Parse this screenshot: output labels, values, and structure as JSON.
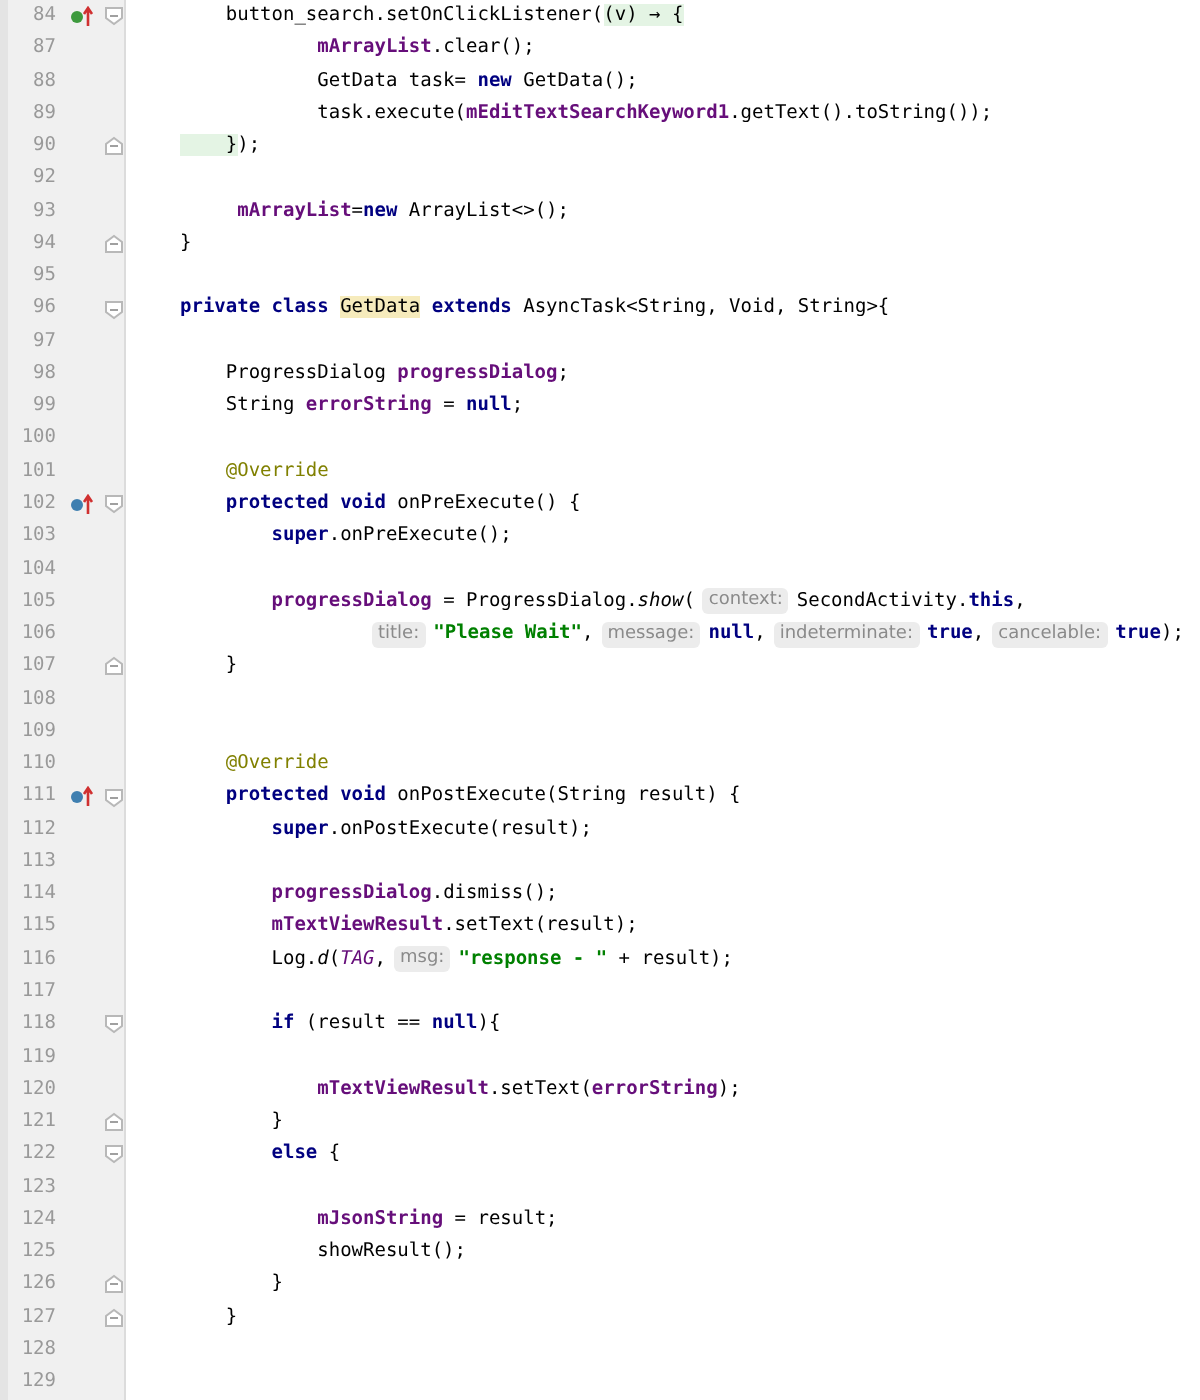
{
  "lines": [
    {
      "number": "84",
      "marker": {
        "kind": "implements"
      },
      "fold": {
        "kind": "start"
      },
      "tokens": [
        {
          "kind": "plain",
          "text": "    button_search.setOnClickListener("
        },
        {
          "kind": "lambda",
          "text": "(v) → {"
        }
      ]
    },
    {
      "number": "87",
      "tokens": [
        {
          "kind": "field",
          "text": "            mArrayList"
        },
        {
          "kind": "plain",
          "text": ".clear();"
        }
      ]
    },
    {
      "number": "88",
      "tokens": [
        {
          "kind": "plain",
          "text": "            GetData task= "
        },
        {
          "kind": "keyword",
          "text": "new"
        },
        {
          "kind": "plain",
          "text": " GetData();"
        }
      ]
    },
    {
      "number": "89",
      "tokens": [
        {
          "kind": "plain",
          "text": "            task.execute("
        },
        {
          "kind": "field",
          "text": "mEditTextSearchKeyword1"
        },
        {
          "kind": "plain",
          "text": ".getText().toString());"
        }
      ]
    },
    {
      "number": "90",
      "fold": {
        "kind": "end"
      },
      "tokens": [
        {
          "kind": "lambda",
          "text": "    }"
        },
        {
          "kind": "plain",
          "text": ");"
        }
      ]
    },
    {
      "number": "92"
    },
    {
      "number": "93",
      "tokens": [
        {
          "kind": "field",
          "text": "     mArrayList"
        },
        {
          "kind": "plain",
          "text": "="
        },
        {
          "kind": "keyword",
          "text": "new"
        },
        {
          "kind": "plain",
          "text": " ArrayList<>();"
        }
      ]
    },
    {
      "number": "94",
      "fold": {
        "kind": "end"
      },
      "tokens": [
        {
          "kind": "plain",
          "text": "}"
        }
      ]
    },
    {
      "number": "95"
    },
    {
      "number": "96",
      "fold": {
        "kind": "start"
      },
      "tokens": [
        {
          "kind": "keyword",
          "text": "private class "
        },
        {
          "kind": "highlight",
          "text": "GetData"
        },
        {
          "kind": "keyword",
          "text": " extends"
        },
        {
          "kind": "plain",
          "text": " AsyncTask<String, Void, String>{"
        }
      ]
    },
    {
      "number": "97"
    },
    {
      "number": "98",
      "tokens": [
        {
          "kind": "plain",
          "text": "    ProgressDialog "
        },
        {
          "kind": "field",
          "text": "progressDialog"
        },
        {
          "kind": "plain",
          "text": ";"
        }
      ]
    },
    {
      "number": "99",
      "tokens": [
        {
          "kind": "plain",
          "text": "    String "
        },
        {
          "kind": "field",
          "text": "errorString"
        },
        {
          "kind": "plain",
          "text": " = "
        },
        {
          "kind": "keyword",
          "text": "null"
        },
        {
          "kind": "plain",
          "text": ";"
        }
      ]
    },
    {
      "number": "100"
    },
    {
      "number": "101",
      "tokens": [
        {
          "kind": "annotation",
          "text": "    @Override"
        }
      ]
    },
    {
      "number": "102",
      "marker": {
        "kind": "overrides"
      },
      "fold": {
        "kind": "start"
      },
      "tokens": [
        {
          "kind": "keyword",
          "text": "    protected void"
        },
        {
          "kind": "plain",
          "text": " onPreExecute() {"
        }
      ]
    },
    {
      "number": "103",
      "tokens": [
        {
          "kind": "keyword",
          "text": "        super"
        },
        {
          "kind": "plain",
          "text": ".onPreExecute();"
        }
      ]
    },
    {
      "number": "104"
    },
    {
      "number": "105",
      "tokens": [
        {
          "kind": "field",
          "text": "        progressDialog"
        },
        {
          "kind": "plain",
          "text": " = ProgressDialog."
        },
        {
          "kind": "italic",
          "text": "show"
        },
        {
          "kind": "plain",
          "text": "("
        },
        {
          "kind": "hint",
          "text": "context:"
        },
        {
          "kind": "plain",
          "text": "SecondActivity."
        },
        {
          "kind": "keyword",
          "text": "this"
        },
        {
          "kind": "plain",
          "text": ","
        }
      ]
    },
    {
      "number": "106",
      "continuation": true,
      "tokens": [
        {
          "kind": "hint",
          "text": "title:"
        },
        {
          "kind": "string",
          "text": "\"Please Wait\""
        },
        {
          "kind": "plain",
          "text": ","
        },
        {
          "kind": "hint",
          "text": "message:"
        },
        {
          "kind": "keyword",
          "text": "null"
        },
        {
          "kind": "plain",
          "text": ","
        },
        {
          "kind": "hint",
          "text": "indeterminate:"
        },
        {
          "kind": "keyword",
          "text": "true"
        },
        {
          "kind": "plain",
          "text": ","
        },
        {
          "kind": "hint",
          "text": "cancelable:"
        },
        {
          "kind": "keyword",
          "text": "true"
        },
        {
          "kind": "plain",
          "text": ");"
        }
      ]
    },
    {
      "number": "107",
      "fold": {
        "kind": "end"
      },
      "tokens": [
        {
          "kind": "plain",
          "text": "    }"
        }
      ]
    },
    {
      "number": "108"
    },
    {
      "number": "109"
    },
    {
      "number": "110",
      "tokens": [
        {
          "kind": "annotation",
          "text": "    @Override"
        }
      ]
    },
    {
      "number": "111",
      "marker": {
        "kind": "overrides"
      },
      "fold": {
        "kind": "start"
      },
      "tokens": [
        {
          "kind": "keyword",
          "text": "    protected void"
        },
        {
          "kind": "plain",
          "text": " onPostExecute(String result) {"
        }
      ]
    },
    {
      "number": "112",
      "tokens": [
        {
          "kind": "keyword",
          "text": "        super"
        },
        {
          "kind": "plain",
          "text": ".onPostExecute(result);"
        }
      ]
    },
    {
      "number": "113"
    },
    {
      "number": "114",
      "tokens": [
        {
          "kind": "field",
          "text": "        progressDialog"
        },
        {
          "kind": "plain",
          "text": ".dismiss();"
        }
      ]
    },
    {
      "number": "115",
      "tokens": [
        {
          "kind": "field",
          "text": "        mTextViewResult"
        },
        {
          "kind": "plain",
          "text": ".setText(result);"
        }
      ]
    },
    {
      "number": "116",
      "tokens": [
        {
          "kind": "plain",
          "text": "        Log."
        },
        {
          "kind": "italic",
          "text": "d"
        },
        {
          "kind": "plain",
          "text": "("
        },
        {
          "kind": "static",
          "text": "TAG"
        },
        {
          "kind": "plain",
          "text": ","
        },
        {
          "kind": "hint",
          "text": "msg:"
        },
        {
          "kind": "string",
          "text": "\"response - \""
        },
        {
          "kind": "plain",
          "text": " + result);"
        }
      ]
    },
    {
      "number": "117"
    },
    {
      "number": "118",
      "fold": {
        "kind": "start"
      },
      "tokens": [
        {
          "kind": "keyword",
          "text": "        if"
        },
        {
          "kind": "plain",
          "text": " (result == "
        },
        {
          "kind": "keyword",
          "text": "null"
        },
        {
          "kind": "plain",
          "text": "){"
        }
      ]
    },
    {
      "number": "119"
    },
    {
      "number": "120",
      "tokens": [
        {
          "kind": "field",
          "text": "            mTextViewResult"
        },
        {
          "kind": "plain",
          "text": ".setText("
        },
        {
          "kind": "field",
          "text": "errorString"
        },
        {
          "kind": "plain",
          "text": ");"
        }
      ]
    },
    {
      "number": "121",
      "fold": {
        "kind": "end"
      },
      "tokens": [
        {
          "kind": "plain",
          "text": "        }"
        }
      ]
    },
    {
      "number": "122",
      "fold": {
        "kind": "start"
      },
      "tokens": [
        {
          "kind": "keyword",
          "text": "        else"
        },
        {
          "kind": "plain",
          "text": " {"
        }
      ]
    },
    {
      "number": "123"
    },
    {
      "number": "124",
      "tokens": [
        {
          "kind": "field",
          "text": "            mJsonString"
        },
        {
          "kind": "plain",
          "text": " = result;"
        }
      ]
    },
    {
      "number": "125",
      "tokens": [
        {
          "kind": "plain",
          "text": "            showResult();"
        }
      ]
    },
    {
      "number": "126",
      "fold": {
        "kind": "end"
      },
      "tokens": [
        {
          "kind": "plain",
          "text": "        }"
        }
      ]
    },
    {
      "number": "127",
      "fold": {
        "kind": "end"
      },
      "tokens": [
        {
          "kind": "plain",
          "text": "    }"
        }
      ]
    },
    {
      "number": "128"
    },
    {
      "number": "129"
    }
  ]
}
